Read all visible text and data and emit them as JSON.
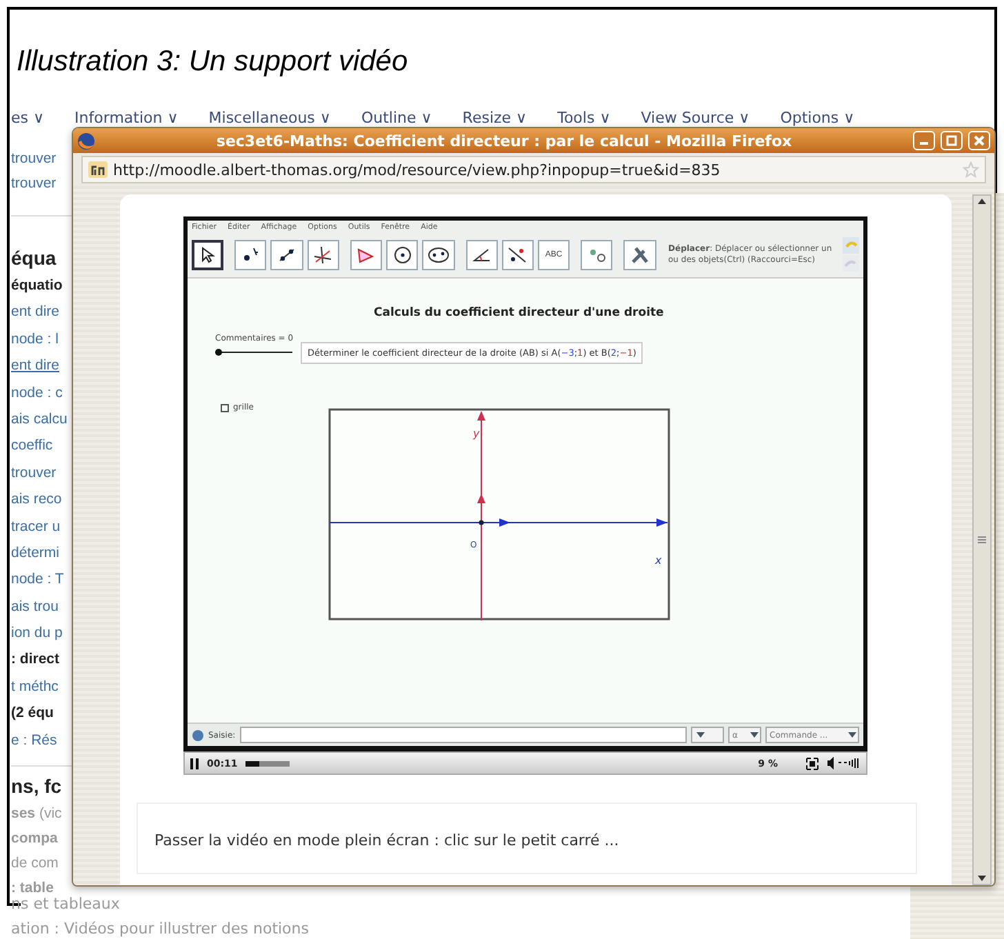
{
  "caption": "Illustration 3: Un support vidéo",
  "background_page": {
    "menu": [
      "es ∨",
      "Information ∨",
      "Miscellaneous ∨",
      "Outline ∨",
      "Resize ∨",
      "Tools ∨",
      "View Source ∨",
      "Options ∨"
    ],
    "top_links": [
      "trouver",
      "trouver"
    ],
    "section_1": {
      "heading": "équa",
      "items": [
        {
          "text": "équatio",
          "kind": "bold"
        },
        {
          "text": "ent dire",
          "kind": "link"
        },
        {
          "text": "node : l",
          "kind": "link"
        },
        {
          "text": "ent dire",
          "kind": "underlined"
        },
        {
          "text": "node : c",
          "kind": "link"
        },
        {
          "text": "ais calcu",
          "kind": "link"
        },
        {
          "text": " coeffic",
          "kind": "link"
        },
        {
          "text": "trouver",
          "kind": "link"
        },
        {
          "text": "ais reco",
          "kind": "link"
        },
        {
          "text": "tracer u",
          "kind": "link"
        },
        {
          "text": "détermi",
          "kind": "link"
        },
        {
          "text": "node : T",
          "kind": "link"
        },
        {
          "text": "ais trou",
          "kind": "link"
        },
        {
          "text": "ion du p",
          "kind": "link"
        },
        {
          "text": ": direct",
          "kind": "bold"
        },
        {
          "text": "t méthc",
          "kind": "link"
        },
        {
          "text": "(2 équ",
          "kind": "bold"
        },
        {
          "text": "e : Rés",
          "kind": "link"
        }
      ]
    },
    "section_2": {
      "heading": "ns, fc",
      "items": [
        {
          "text": "**ses** (vic",
          "kind": "muted"
        },
        {
          "text": "**compa**",
          "kind": "muted"
        },
        {
          "text": "de com",
          "kind": "muted"
        },
        {
          "text": "**: table**",
          "kind": "muted"
        }
      ]
    },
    "bottom_items": [
      "ns et tableaux",
      "ation : Vidéos pour illustrer des notions"
    ]
  },
  "browser": {
    "title": "sec3et6-Maths: Coefficient directeur : par le calcul - Mozilla Firefox",
    "url": "http://moodle.albert-thomas.org/mod/resource/view.php?inpopup=true&id=835",
    "video": {
      "menu": [
        "Fichier",
        "Éditer",
        "Affichage",
        "Options",
        "Outils",
        "Fenêtre",
        "Aide"
      ],
      "tools": [
        {
          "kind": "move",
          "selected": true
        },
        {
          "kind": "point",
          "selected": false
        },
        {
          "kind": "line",
          "selected": false
        },
        {
          "kind": "perpendicular",
          "selected": false
        },
        {
          "kind": "polygon",
          "selected": false
        },
        {
          "kind": "circle",
          "selected": false
        },
        {
          "kind": "ellipse",
          "selected": false
        },
        {
          "kind": "angle",
          "selected": false
        },
        {
          "kind": "reflect",
          "selected": false
        },
        {
          "kind": "text",
          "label": "ABC",
          "selected": false
        },
        {
          "kind": "slider",
          "selected": false
        },
        {
          "kind": "tools",
          "selected": false
        }
      ],
      "help": "**Déplacer**: Déplacer ou sélectionner un ou des objets(Ctrl) (Raccourci=Esc)",
      "title": "Calculs du coefficient directeur d'une droite",
      "slider": {
        "label": "Commentaires = 0",
        "level": 0
      },
      "task": [
        {
          "text": "Déterminer le coefficient directeur de la droite (AB) si A("
        },
        {
          "text": "−3",
          "color": "#3344ff"
        },
        {
          "text": ";"
        },
        {
          "text": "1",
          "color": "#dd2222"
        },
        {
          "text": ") et B("
        },
        {
          "text": "2",
          "color": "#3344ff"
        },
        {
          "text": ";"
        },
        {
          "text": "−1",
          "color": "#dd2222"
        },
        {
          "text": ")"
        }
      ],
      "grid_checkbox": {
        "label": "grille",
        "checked": false
      },
      "graph": {
        "x_label": "x",
        "y_label": "y",
        "origin_label": "O"
      },
      "input_bar": {
        "label": "Saisie:",
        "dropdowns": [
          "α",
          "Commande ..."
        ]
      },
      "controls": {
        "playing": true,
        "time": "00:11",
        "level": 0.3,
        "buffer": "9 %"
      }
    },
    "note": "Passer la vidéo en mode plein écran : clic sur le petit carré ..."
  }
}
